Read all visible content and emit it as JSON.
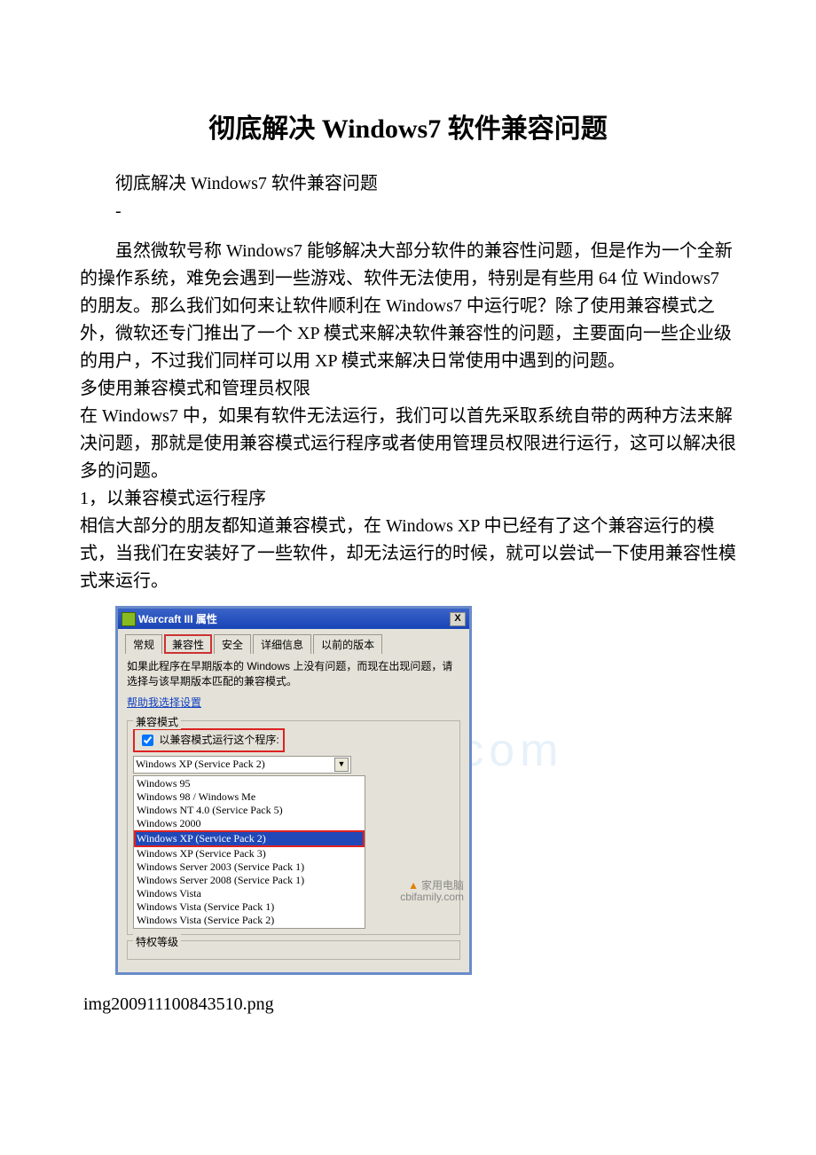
{
  "title": "彻底解决 Windows7 软件兼容问题",
  "p_sub": "彻底解决 Windows7 软件兼容问题",
  "dash": "-",
  "p_intro": "　　虽然微软号称 Windows7 能够解决大部分软件的兼容性问题，但是作为一个全新的操作系统，难免会遇到一些游戏、软件无法使用，特别是有些用 64 位 Windows7 的朋友。那么我们如何来让软件顺利在 Windows7 中运行呢？除了使用兼容模式之外，微软还专门推出了一个 XP 模式来解决软件兼容性的问题，主要面向一些企业级的用户，不过我们同样可以用 XP 模式来解决日常使用中遇到的问题。",
  "p_multi": "多使用兼容模式和管理员权限",
  "p_win7": "在 Windows7 中，如果有软件无法运行，我们可以首先采取系统自带的两种方法来解决问题，那就是使用兼容模式运行程序或者使用管理员权限进行运行，这可以解决很多的问题。",
  "p_h1": "1，以兼容模式运行程序",
  "p_h1b": "相信大部分的朋友都知道兼容模式，在 Windows XP 中已经有了这个兼容运行的模式，当我们在安装好了一些软件，却无法运行的时候，就可以尝试一下使用兼容性模式来运行。",
  "dlg": {
    "title": "Warcraft III 属性",
    "close": "X",
    "tabs": {
      "t1": "常规",
      "t2": "兼容性",
      "t3": "安全",
      "t4": "详细信息",
      "t5": "以前的版本"
    },
    "desc": "如果此程序在早期版本的 Windows 上没有问题，而现在出现问题，请选择与该早期版本匹配的兼容模式。",
    "help": "帮助我选择设置",
    "group1": "兼容模式",
    "chk": "以兼容模式运行这个程序:",
    "selected": "Windows XP (Service Pack 2)",
    "list": [
      "Windows 95",
      "Windows 98 / Windows Me",
      "Windows NT 4.0 (Service Pack 5)",
      "Windows 2000",
      "Windows XP (Service Pack 2)",
      "Windows XP (Service Pack 3)",
      "Windows Server 2003 (Service Pack 1)",
      "Windows Server 2008 (Service Pack 1)",
      "Windows Vista",
      "Windows Vista (Service Pack 1)",
      "Windows Vista (Service Pack 2)"
    ],
    "group2": "特权等级",
    "logo1": "家用电脑",
    "logo2": "cbifamily.com"
  },
  "caption": "img200911100843510.png"
}
